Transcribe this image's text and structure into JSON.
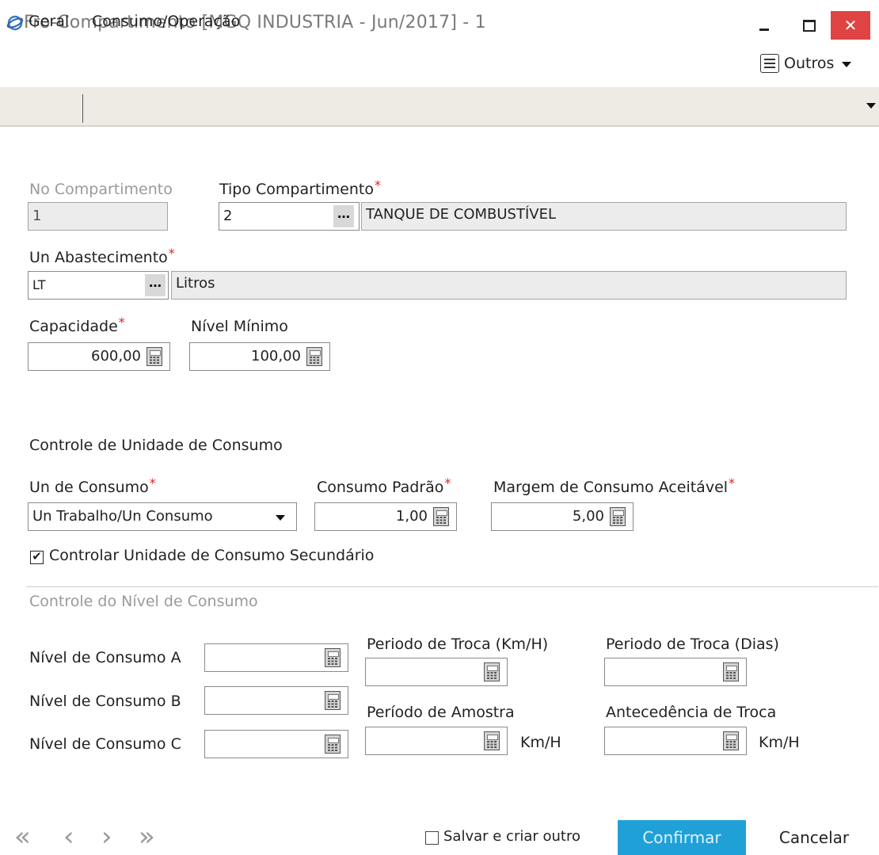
{
  "window": {
    "title": "Fro-Compartimento [MGQ INDUSTRIA - Jun/2017]  - 1",
    "close_glyph": "✕"
  },
  "toolbar": {
    "outros_label": "Outros"
  },
  "tabs": {
    "geral": "Geral",
    "consumo": "Consumo/Operação"
  },
  "form": {
    "no_compartimento": {
      "label": "No Compartimento",
      "value": "1"
    },
    "tipo_compartimento": {
      "label": "Tipo Compartimento",
      "value": "2",
      "desc": "TANQUE DE COMBUSTÍVEL"
    },
    "un_abastecimento": {
      "label": "Un Abastecimento",
      "value": "LT",
      "desc": "Litros"
    },
    "capacidade": {
      "label": "Capacidade",
      "value": "600,00"
    },
    "nivel_minimo": {
      "label": "Nível Mínimo",
      "value": "100,00"
    },
    "required_mark": "*",
    "dots": "…"
  },
  "controle_unidade": {
    "title": "Controle de Unidade de Consumo",
    "un_consumo": {
      "label": "Un de Consumo",
      "value": "Un Trabalho/Un Consumo"
    },
    "consumo_padrao": {
      "label": "Consumo Padrão",
      "value": "1,00"
    },
    "margem": {
      "label": "Margem de Consumo Aceitável",
      "value": "5,00"
    },
    "secundario": {
      "label": "Controlar Unidade de Consumo Secundário",
      "checked": true,
      "check_glyph": "✔"
    }
  },
  "controle_nivel": {
    "title": "Controle do Nível de Consumo",
    "nivel_a": {
      "label": "Nível de Consumo A",
      "value": ""
    },
    "nivel_b": {
      "label": "Nível de Consumo B",
      "value": ""
    },
    "nivel_c": {
      "label": "Nível de Consumo C",
      "value": ""
    },
    "periodo_troca_km": {
      "label": "Periodo de Troca (Km/H)",
      "value": ""
    },
    "periodo_troca_dias": {
      "label": "Periodo de Troca (Dias)",
      "value": ""
    },
    "periodo_amostra": {
      "label": "Período de Amostra",
      "value": "",
      "unit": "Km/H"
    },
    "antecedencia": {
      "label": "Antecedência de Troca",
      "value": "",
      "unit": "Km/H"
    }
  },
  "footer": {
    "nav_first": "«",
    "nav_prev": "‹",
    "nav_next": "›",
    "nav_last": "»",
    "salvar_label": "Salvar e criar outro",
    "salvar_checked": false,
    "confirm_label": "Confirmar",
    "cancel_label": "Cancelar"
  },
  "colors": {
    "accent": "#1fa1d8",
    "close": "#e04343",
    "required": "#e02020",
    "tabbar": "#eeeae4"
  }
}
